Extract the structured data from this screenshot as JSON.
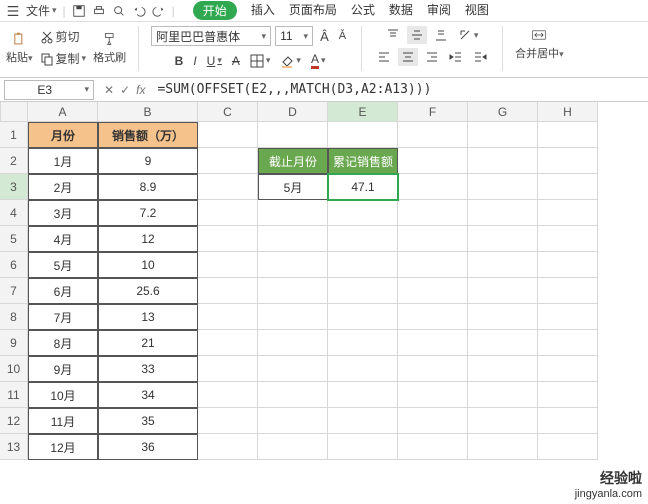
{
  "quickbar": {
    "menu_label": "文件",
    "menus": {
      "start": "开始",
      "insert": "插入",
      "layout": "页面布局",
      "formula": "公式",
      "data": "数据",
      "review": "审阅",
      "view": "视图"
    }
  },
  "ribbon": {
    "cut": "剪切",
    "copy": "复制",
    "paste": "粘贴",
    "format_painter": "格式刷",
    "font_name": "阿里巴巴普惠体",
    "font_size": "11",
    "merge": "合并居中"
  },
  "formula_bar": {
    "cell_ref": "E3",
    "formula": "=SUM(OFFSET(E2,,,MATCH(D3,A2:A13)))"
  },
  "columns": [
    "A",
    "B",
    "C",
    "D",
    "E",
    "F",
    "G",
    "H"
  ],
  "rows_count": 13,
  "headers": {
    "a": "月份",
    "b": "销售额（万）"
  },
  "summary": {
    "d2": "截止月份",
    "e2": "累记销售额",
    "d3": "5月",
    "e3": "47.1"
  },
  "table": [
    {
      "m": "1月",
      "v": "9"
    },
    {
      "m": "2月",
      "v": "8.9"
    },
    {
      "m": "3月",
      "v": "7.2"
    },
    {
      "m": "4月",
      "v": "12"
    },
    {
      "m": "5月",
      "v": "10"
    },
    {
      "m": "6月",
      "v": "25.6"
    },
    {
      "m": "7月",
      "v": "13"
    },
    {
      "m": "8月",
      "v": "21"
    },
    {
      "m": "9月",
      "v": "33"
    },
    {
      "m": "10月",
      "v": "34"
    },
    {
      "m": "11月",
      "v": "35"
    },
    {
      "m": "12月",
      "v": "36"
    }
  ],
  "watermark": {
    "title": "经验啦",
    "url": "jingyanla.com"
  }
}
